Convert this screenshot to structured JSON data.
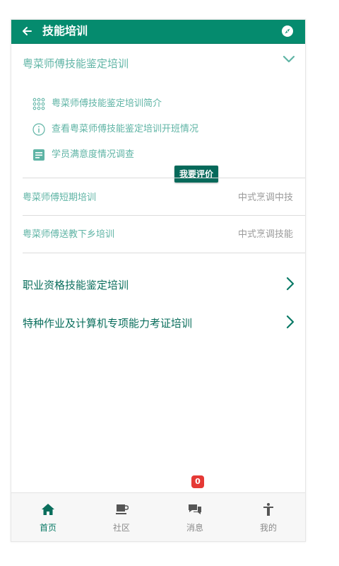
{
  "header": {
    "title": "技能培训",
    "back_icon": "arrow-left-icon",
    "right_icon": "compass-icon"
  },
  "expanded_section": {
    "label": "粤菜师傅技能鉴定培训",
    "items": [
      {
        "label": "粤菜师傅技能鉴定培训简介",
        "icon": "grid-dots-icon"
      },
      {
        "label": "查看粤菜师傅技能鉴定培训开班情况",
        "icon": "info-circle-icon"
      },
      {
        "label": "学员满意度情况调查",
        "icon": "document-icon",
        "button": "我要评价"
      }
    ]
  },
  "rows": [
    {
      "left": "粤菜师傅短期培训",
      "right": "中式烹调中技"
    },
    {
      "left": "粤菜师傅送教下乡培训",
      "right": "中式烹调技能"
    }
  ],
  "categories": [
    {
      "label": "职业资格技能鉴定培训"
    },
    {
      "label": "特种作业及计算机专项能力考证培训"
    }
  ],
  "tabbar": [
    {
      "label": "首页",
      "icon": "home-icon"
    },
    {
      "label": "社区",
      "icon": "coffee-cup-icon"
    },
    {
      "label": "消息",
      "icon": "chat-bubbles-icon"
    },
    {
      "label": "我的",
      "icon": "person-icon"
    }
  ],
  "message_badge": "0",
  "colors": {
    "brand": "#058b6e",
    "teal_text": "#5fb4a5",
    "button": "#06695a",
    "badge": "#e53935"
  }
}
